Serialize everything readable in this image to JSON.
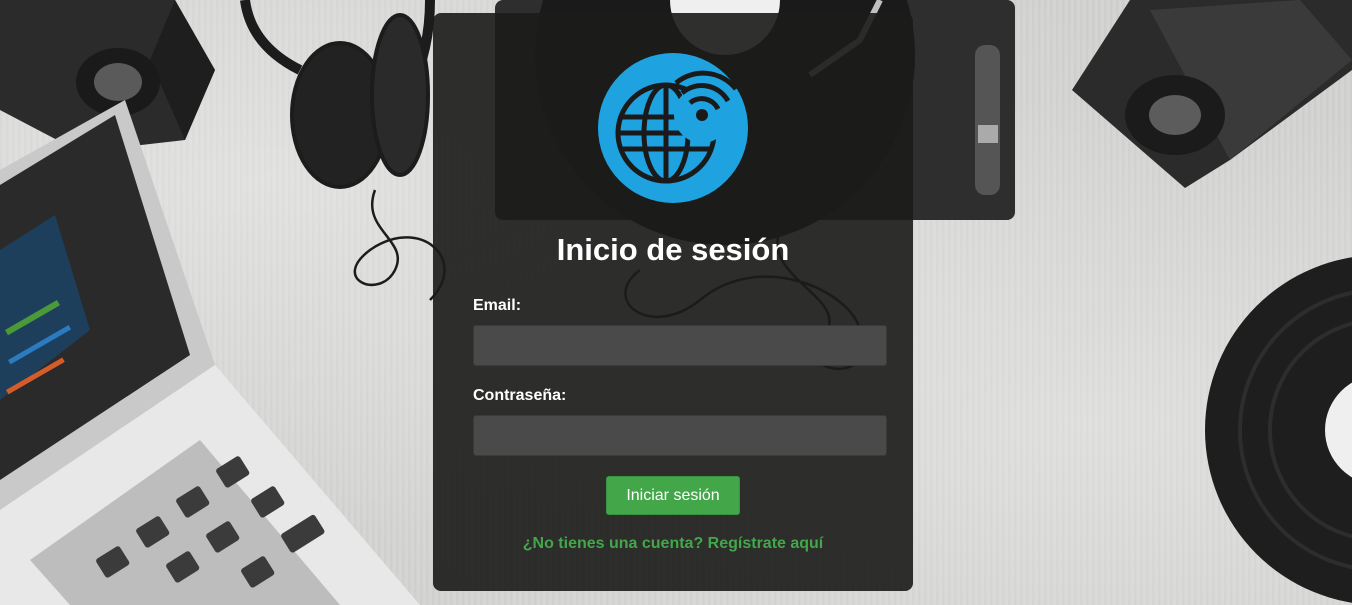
{
  "login": {
    "title": "Inicio de sesión",
    "email_label": "Email:",
    "email_value": "",
    "email_placeholder": "",
    "password_label": "Contraseña:",
    "password_value": "",
    "password_placeholder": "",
    "submit_label": "Iniciar sesión",
    "register_link": "¿No tienes una cuenta? Regístrate aquí"
  },
  "logo": {
    "icon": "globe-wifi-icon",
    "circle_color": "#1fa3e0",
    "symbol_color": "#1a1a1a"
  },
  "colors": {
    "card_background": "#1c1c1a",
    "input_background": "#4a4a4a",
    "accent_green": "#43a74a",
    "text_white": "#ffffff"
  }
}
